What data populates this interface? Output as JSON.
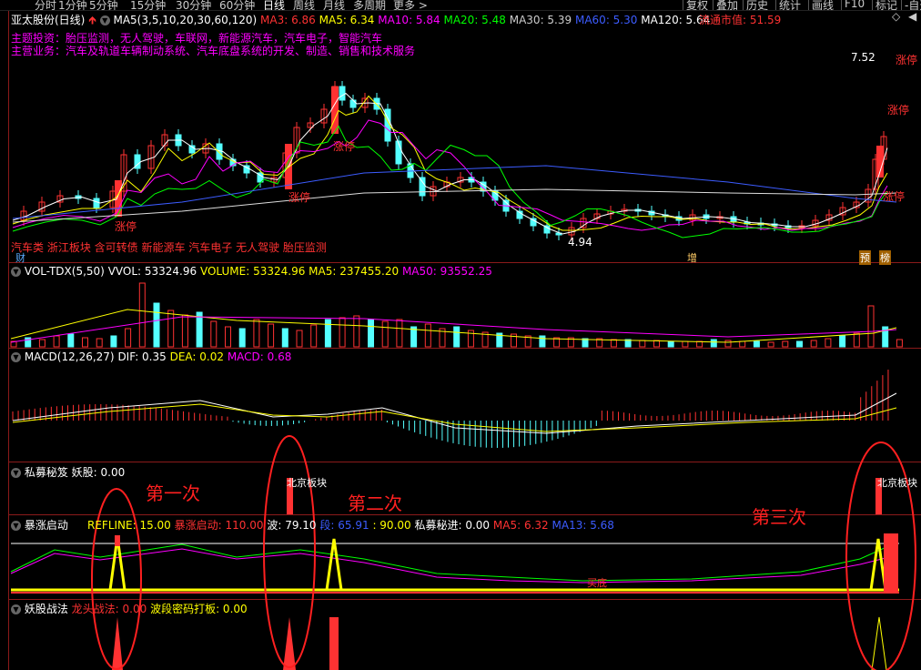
{
  "topbar": {
    "tabs": [
      "分时",
      "1分钟",
      "5分钟",
      "15分钟",
      "30分钟",
      "60分钟",
      "日线",
      "周线",
      "月线",
      "多周期",
      "更多 >"
    ],
    "active_tab": "日线",
    "right_tabs": [
      "复权",
      "叠加",
      "历史",
      "统计",
      "画线",
      "F10",
      "标记",
      "-自选"
    ]
  },
  "main": {
    "stock_title": "亚太股份(日线)",
    "ma_label": "MA5(3,5,10,20,30,60,120)",
    "ma3": "MA3: 6.86",
    "ma5": "MA5: 6.34",
    "ma10": "MA10: 5.84",
    "ma20": "MA20: 5.48",
    "ma30": "MA30: 5.39",
    "ma60": "MA60: 5.30",
    "ma120": "MA120: 5.64",
    "market_cap": "流通市值: 51.59",
    "theme_line": "主题投资：胎压监测，无人驾驶，车联网，新能源汽车，汽车电子，智能汽车",
    "business_line": "主营业务：汽车及轨道车辆制动系统、汽车底盘系统的开发、制造、销售和技术服务",
    "concept_line": "汽车类 浙江板块 含可转债 新能源车 汽车电子 无人驾驶 胎压监测",
    "high_label": "7.52",
    "low_label": "4.94",
    "limit_up": "涨停",
    "badge_cai": "财",
    "badge_zeng": "增",
    "badge_yu": "预",
    "badge_bang": "榜"
  },
  "vol": {
    "label": "VOL-TDX(5,50)",
    "vvol": "VVOL: 53324.96",
    "volume": "VOLUME: 53324.96",
    "ma5": "MA5: 237455.20",
    "ma50": "MA50: 93552.25"
  },
  "macd": {
    "label": "MACD(12,26,27)",
    "dif": "DIF: 0.35",
    "dea": "DEA: 0.02",
    "macd": "MACD: 0.68"
  },
  "simu": {
    "label": "私募秘笈",
    "value": "妖股: 0.00",
    "tag": "北京板块"
  },
  "baozhang": {
    "label": "暴涨启动",
    "refline": "REFLINE: 15.00",
    "qidong": "暴涨启动: 110.00",
    "bo": "波: 79.10",
    "duan": "段: 65.91",
    "ninety": ": 90.00",
    "mijin": "私募秘进: 0.00",
    "ma5": "MA5: 6.32",
    "ma13": "MA13: 5.68",
    "maidi": "买底"
  },
  "yaogu": {
    "label": "妖股战法",
    "longtou": "龙头战法: 0.00",
    "boduan": "波段密码打板: 0.00"
  },
  "annotations": {
    "first": "第一次",
    "second": "第二次",
    "third": "第三次"
  },
  "colors": {
    "up": "#ff3232",
    "down": "#54ffff",
    "ma3": "#ffffff",
    "ma5": "#ffff00",
    "ma10": "#ff00ff",
    "ma20": "#00ff00",
    "ma60": "#3c5cff",
    "annotation": "#ff2020"
  }
}
